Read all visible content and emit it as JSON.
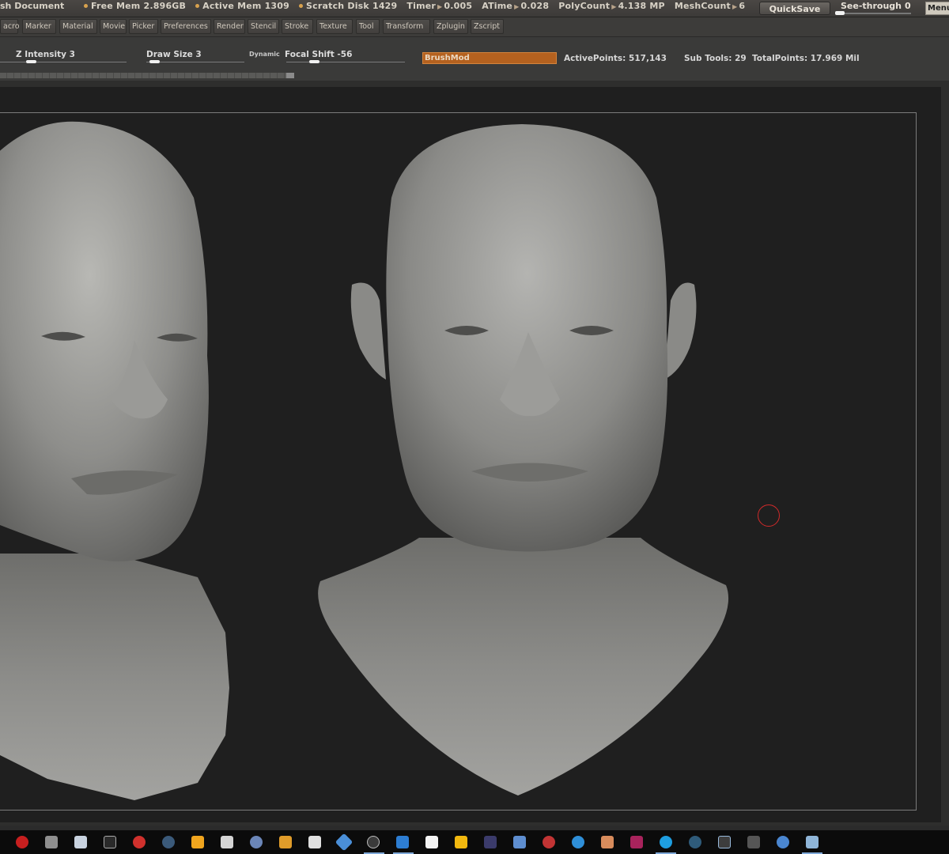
{
  "titlebar": {
    "document_label": "sh Document",
    "stats": [
      {
        "label": "Free Mem",
        "value": "2.896GB",
        "marker": "dot"
      },
      {
        "label": "Active Mem",
        "value": "1309",
        "marker": "dot"
      },
      {
        "label": "Scratch Disk",
        "value": "1429",
        "marker": "dot"
      },
      {
        "label": "Timer",
        "value": "0.005",
        "marker": "none"
      },
      {
        "label": "ATime",
        "value": "0.028",
        "marker": "none"
      },
      {
        "label": "PolyCount",
        "value": "4.138 MP",
        "marker": "none"
      },
      {
        "label": "MeshCount",
        "value": "6",
        "marker": "none"
      }
    ],
    "quicksave_label": "QuickSave",
    "see_through_label": "See-through",
    "see_through_value": "0",
    "menu_label": "Menu"
  },
  "menus": [
    "acro",
    "Marker",
    "Material",
    "Movie",
    "Picker",
    "Preferences",
    "Render",
    "Stencil",
    "Stroke",
    "Texture",
    "Tool",
    "Transform",
    "Zplugin",
    "Zscript"
  ],
  "shelf": {
    "z_intensity": {
      "label": "Z Intensity",
      "value": "3"
    },
    "draw_size": {
      "label": "Draw Size",
      "value": "3"
    },
    "dynamic_label": "Dynamic",
    "focal_shift": {
      "label": "Focal Shift",
      "value": "-56"
    },
    "brush_name": "BrushMod",
    "active_points": {
      "label": "ActivePoints:",
      "value": "517,143"
    },
    "sub_tools": {
      "label": "Sub Tools:",
      "value": "29"
    },
    "total_points": {
      "label": "TotalPoints:",
      "value": "17.969 Mil"
    }
  },
  "taskbar_icons": [
    "record-icon",
    "person-icon",
    "document-icon",
    "tool-icon",
    "red-app-icon",
    "steam-icon",
    "lock-icon",
    "microphone-icon",
    "globe-icon",
    "image-editor-icon",
    "unity-icon",
    "diamond-icon",
    "obs-icon",
    "vscode-icon",
    "k-icon",
    "m-icon",
    "after-effects-icon",
    "flask-icon",
    "red-app-2-icon",
    "browser-icon",
    "photo-icon",
    "indesign-icon",
    "skype-icon",
    "network-icon",
    "monitor-icon",
    "axis-icon",
    "chrome-icon",
    "picture-icon"
  ],
  "colors": {
    "brush_accent": "#b4611f",
    "cursor_ring": "#d22a2a",
    "canvas_bg": "#1f1f1f"
  }
}
